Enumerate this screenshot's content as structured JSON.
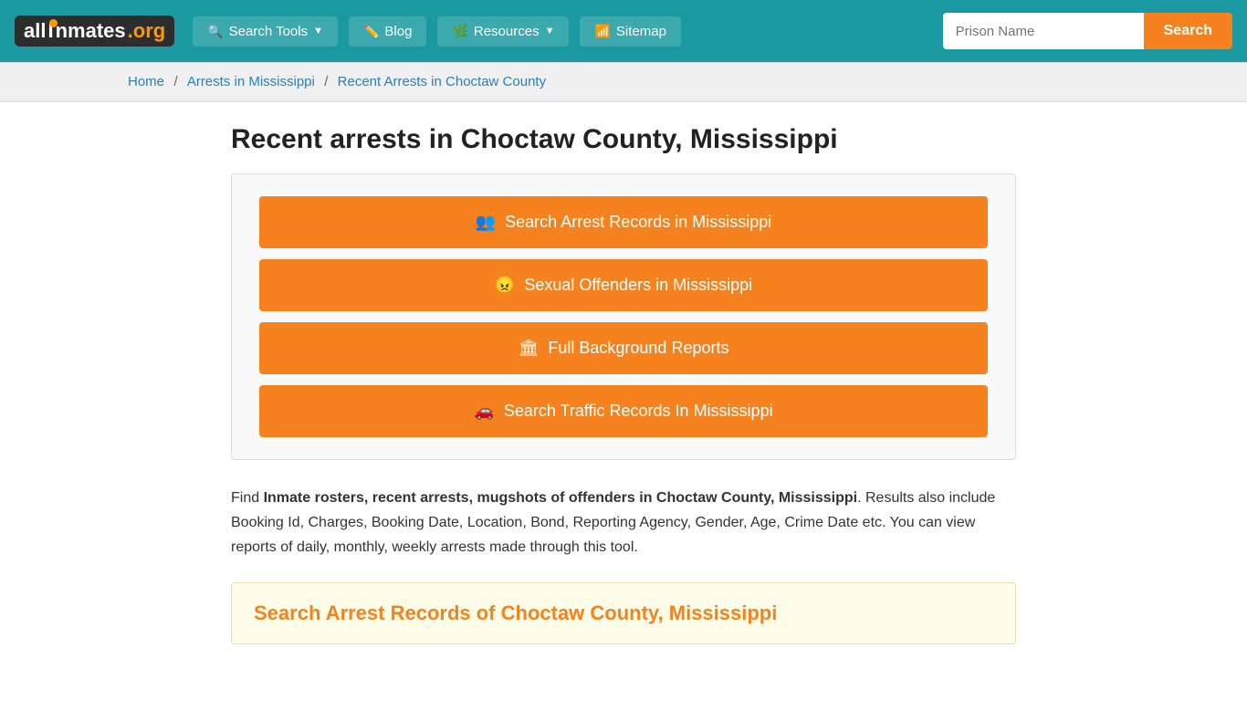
{
  "header": {
    "logo": {
      "text_all": "all",
      "text_i_styled": "I",
      "text_nmates": "nmates",
      "text_org": ".org"
    },
    "nav": [
      {
        "id": "search-tools",
        "label": "Search Tools",
        "has_arrow": true
      },
      {
        "id": "blog",
        "label": "Blog",
        "has_arrow": false
      },
      {
        "id": "resources",
        "label": "Resources",
        "has_arrow": true
      },
      {
        "id": "sitemap",
        "label": "Sitemap",
        "has_arrow": false
      }
    ],
    "search": {
      "placeholder": "Prison Name",
      "button_label": "Search"
    }
  },
  "breadcrumb": {
    "items": [
      {
        "label": "Home",
        "href": "#"
      },
      {
        "label": "Arrests in Mississippi",
        "href": "#"
      },
      {
        "label": "Recent Arrests in Choctaw County",
        "href": "#"
      }
    ]
  },
  "main": {
    "page_title": "Recent arrests in Choctaw County, Mississippi",
    "buttons": [
      {
        "id": "search-arrests",
        "label": "Search Arrest Records in Mississippi",
        "icon": "people"
      },
      {
        "id": "sexual-offenders",
        "label": "Sexual Offenders in Mississippi",
        "icon": "face"
      },
      {
        "id": "background-reports",
        "label": "Full Background Reports",
        "icon": "building"
      },
      {
        "id": "traffic-records",
        "label": "Search Traffic Records In Mississippi",
        "icon": "car"
      }
    ],
    "description_intro": "Find ",
    "description_bold": "Inmate rosters, recent arrests, mugshots of offenders in Choctaw County, Mississippi",
    "description_rest": ". Results also include Booking Id, Charges, Booking Date, Location, Bond, Reporting Agency, Gender, Age, Crime Date etc. You can view reports of daily, monthly, weekly arrests made through this tool.",
    "section_title": "Search Arrest Records of Choctaw County, Mississippi"
  }
}
